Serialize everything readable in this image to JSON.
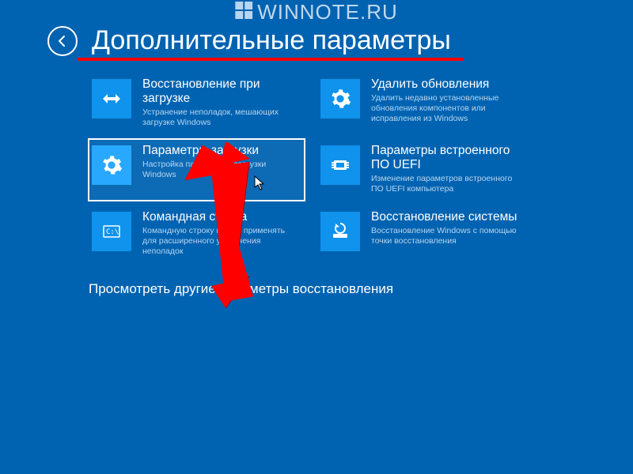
{
  "watermark": {
    "text": "WINNOTE.RU"
  },
  "header": {
    "title": "Дополнительные параметры"
  },
  "tiles": {
    "startup_repair": {
      "title": "Восстановление при загрузке",
      "desc": "Устранение неполадок, мешающих загрузке Windows"
    },
    "uninstall_updates": {
      "title": "Удалить обновления",
      "desc": "Удалить недавно установленные обновления компонентов или исправления из Windows"
    },
    "startup_settings": {
      "title": "Параметры загрузки",
      "desc": "Настройка параметров загрузки Windows"
    },
    "uefi_settings": {
      "title": "Параметры встроенного ПО UEFI",
      "desc": "Изменение параметров встроенного ПО UEFI компьютера"
    },
    "command_prompt": {
      "title": "Командная строка",
      "desc": "Командную строку можно применять для расширенного устранения неполадок"
    },
    "system_restore": {
      "title": "Восстановление системы",
      "desc": "Восстановление Windows с помощью точки восстановления"
    }
  },
  "footer": {
    "more": "Просмотреть другие параметры восстановления"
  },
  "annotation": {
    "underline_color": "#ff0000",
    "arrow_color": "#ff0000"
  }
}
